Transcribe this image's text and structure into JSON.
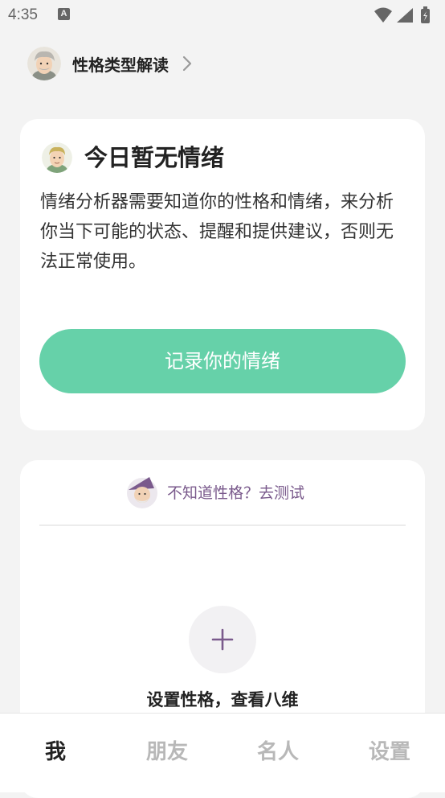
{
  "status_bar": {
    "time": "4:35",
    "a_icon_label": "A",
    "icons": [
      "wifi-icon",
      "signal-icon",
      "battery-icon"
    ]
  },
  "header": {
    "title": "性格类型解读",
    "chevron_icon": "chevron-right-icon"
  },
  "emotion_card": {
    "title": "今日暂无情绪",
    "description": "情绪分析器需要知道你的性格和情绪，来分析你当下可能的状态、提醒和提供建议，否则无法正常使用。",
    "button_label": "记录你的情绪"
  },
  "personality_card": {
    "test_link": "不知道性格？去测试",
    "set_label": "设置性格，查看八维"
  },
  "bottom_nav": {
    "items": [
      {
        "label": "我",
        "active": true
      },
      {
        "label": "朋友",
        "active": false
      },
      {
        "label": "名人",
        "active": false
      },
      {
        "label": "设置",
        "active": false
      }
    ]
  },
  "colors": {
    "accent_green": "#66d1a9",
    "accent_purple": "#7a5a8c",
    "background": "#f3f3f3"
  }
}
